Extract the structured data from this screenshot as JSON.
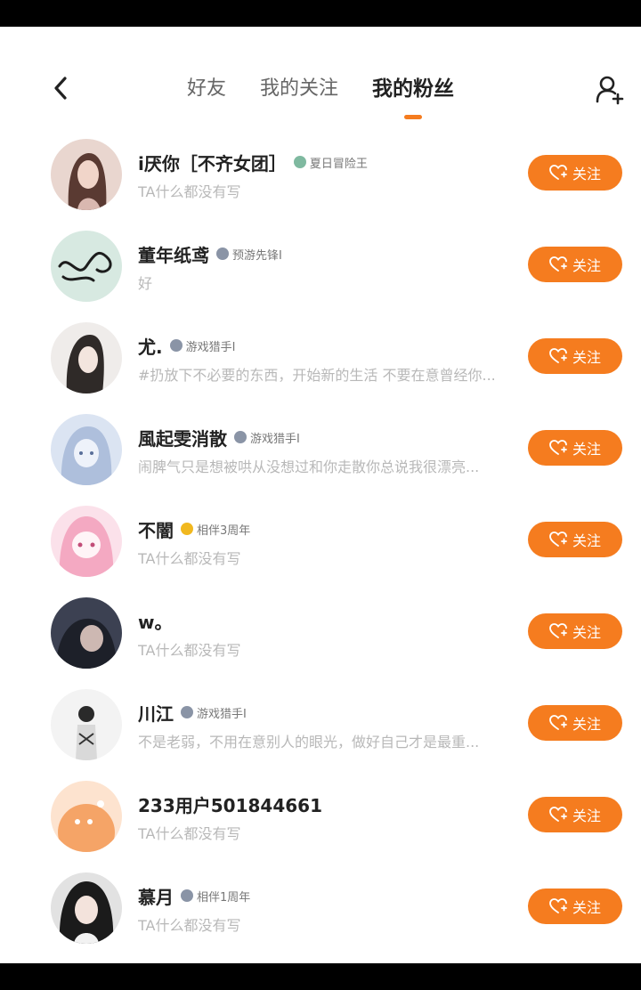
{
  "header": {
    "tabs": [
      {
        "label": "好友",
        "active": false
      },
      {
        "label": "我的关注",
        "active": false
      },
      {
        "label": "我的粉丝",
        "active": true
      }
    ]
  },
  "icons": {
    "back": "back-chevron-icon",
    "add_friend": "add-user-icon",
    "follow": "heart-plus-icon",
    "badge": "badge-icon"
  },
  "colors": {
    "accent": "#f57c1f",
    "text_primary": "#222222",
    "text_secondary": "#b8b8b8"
  },
  "follow_label": "关注",
  "fans": [
    {
      "name": "i厌你［不齐女团］",
      "badge": "夏日冒险王",
      "badge_color": "green",
      "bio": "TA什么都没有写",
      "follow": "关注"
    },
    {
      "name": "董年纸鸢",
      "badge": "预游先锋I",
      "badge_color": "gray",
      "bio": "好",
      "follow": "关注"
    },
    {
      "name": "尤.",
      "badge": "游戏猎手I",
      "badge_color": "gray",
      "bio": "#扔放下不必要的东西，开始新的生活 不要在意曾经你...",
      "follow": "关注"
    },
    {
      "name": "風起雯消散",
      "badge": "游戏猎手I",
      "badge_color": "gray",
      "bio": "闹脾气只是想被哄从没想过和你走散你总说我很漂亮...",
      "follow": "关注"
    },
    {
      "name": "不闇",
      "badge": "相伴3周年",
      "badge_color": "gold",
      "bio": "TA什么都没有写",
      "follow": "关注"
    },
    {
      "name": "w。",
      "badge": "",
      "badge_color": "",
      "bio": "TA什么都没有写",
      "follow": "关注"
    },
    {
      "name": "川江",
      "badge": "游戏猎手I",
      "badge_color": "gray",
      "bio": "不是老弱，不用在意别人的眼光，做好自己才是最重...",
      "follow": "关注"
    },
    {
      "name": "233用户501844661",
      "badge": "",
      "badge_color": "",
      "bio": "TA什么都没有写",
      "follow": "关注"
    },
    {
      "name": "慕月",
      "badge": "相伴1周年",
      "badge_color": "gray",
      "bio": "TA什么都没有写",
      "follow": "关注"
    }
  ]
}
